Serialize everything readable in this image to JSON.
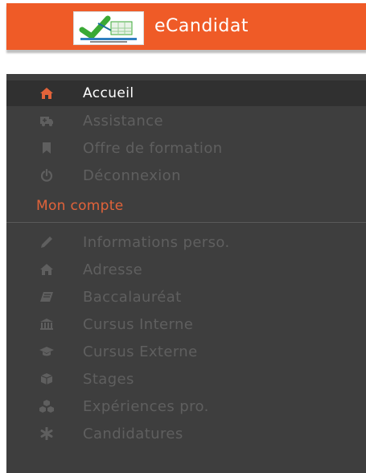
{
  "header": {
    "title": "eCandidat",
    "background_color": "#ef5b27",
    "logo": "ecandidat-logo"
  },
  "sidebar": {
    "background_color": "#3e3e3e",
    "active_color": "#e2633a",
    "main_items": [
      {
        "label": "Accueil",
        "icon": "home-icon",
        "active": true
      },
      {
        "label": "Assistance",
        "icon": "ambulance-icon",
        "active": false
      },
      {
        "label": "Offre de formation",
        "icon": "bookmark-icon",
        "active": false
      },
      {
        "label": "Déconnexion",
        "icon": "power-icon",
        "active": false
      }
    ],
    "account_section": {
      "title": "Mon compte",
      "items": [
        {
          "label": "Informations perso.",
          "icon": "pencil-icon"
        },
        {
          "label": "Adresse",
          "icon": "home-icon"
        },
        {
          "label": "Baccalauréat",
          "icon": "book-icon"
        },
        {
          "label": "Cursus Interne",
          "icon": "institution-icon"
        },
        {
          "label": "Cursus Externe",
          "icon": "graduation-cap-icon"
        },
        {
          "label": "Stages",
          "icon": "cube-icon"
        },
        {
          "label": "Expériences pro.",
          "icon": "cubes-icon"
        },
        {
          "label": "Candidatures",
          "icon": "asterisk-icon"
        }
      ]
    }
  }
}
